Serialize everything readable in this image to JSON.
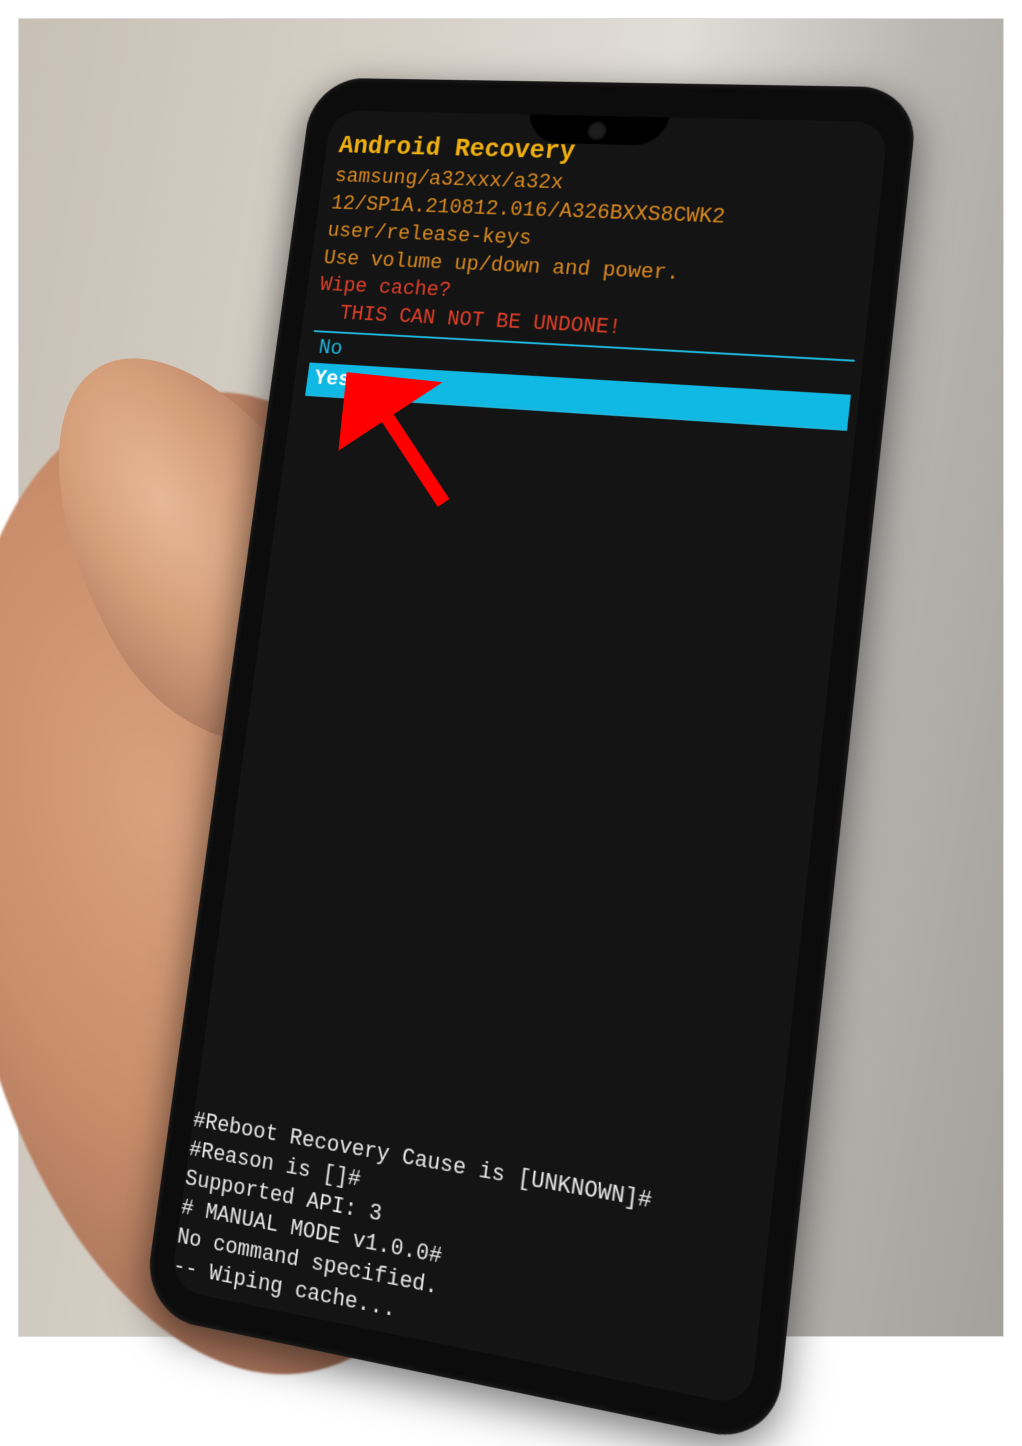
{
  "header": {
    "title": "Android Recovery",
    "device_line": "samsung/a32xxx/a32x",
    "build_line": "12/SP1A.210812.016/A326BXXS8CWK2",
    "keys_line": "user/release-keys",
    "instructions": "Use volume up/down and power."
  },
  "prompt": {
    "question": "Wipe cache?",
    "warning": "  THIS CAN NOT BE UNDONE!"
  },
  "menu": {
    "options": [
      {
        "label": "No",
        "selected": false
      },
      {
        "label": "Yes",
        "selected": true
      }
    ]
  },
  "log": {
    "lines": [
      "#Reboot Recovery Cause is [UNKNOWN]#",
      "#Reason is []#",
      "Supported API: 3",
      "",
      "# MANUAL MODE v1.0.0#",
      "No command specified.",
      "",
      "-- Wiping cache..."
    ]
  },
  "annotation": {
    "kind": "arrow",
    "target": "menu-option-yes",
    "color": "#ff0000"
  }
}
